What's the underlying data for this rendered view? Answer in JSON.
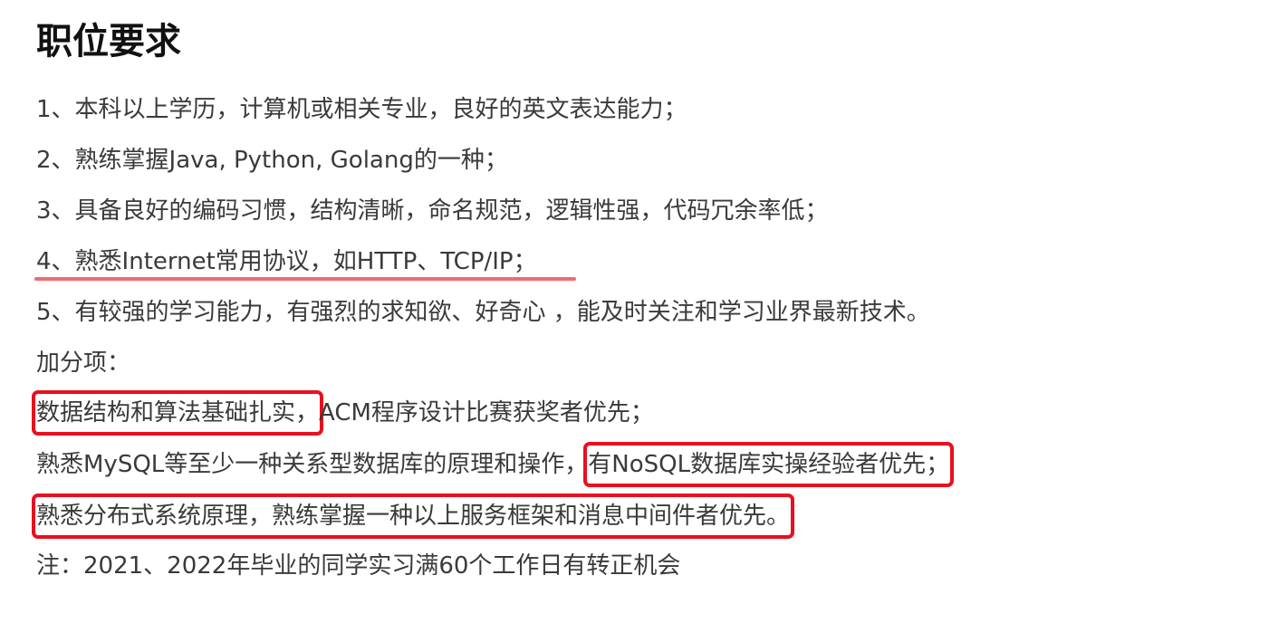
{
  "title": "职位要求",
  "requirements": [
    "1、本科以上学历，计算机或相关专业，良好的英文表达能力；",
    "2、熟练掌握Java, Python, Golang的一种；",
    "3、具备良好的编码习惯，结构清晰，命名规范，逻辑性强，代码冗余率低；",
    "4、熟悉Internet常用协议，如HTTP、TCP/IP；",
    "5、有较强的学习能力，有强烈的求知欲、好奇心 ，能及时关注和学习业界最新技术。"
  ],
  "bonus_heading": "加分项：",
  "bonus": {
    "item1_highlight": "数据结构和算法基础扎实，",
    "item1_rest": "ACM程序设计比赛获奖者优先；",
    "item2_text": "熟悉MySQL等至少一种关系型数据库的原理和操作，",
    "item2_highlight": "有NoSQL数据库实操经验者优先；",
    "item3_highlight": "熟悉分布式系统原理，熟练掌握一种以上服务框架和消息中间件者优先。"
  },
  "note": "注：2021、2022年毕业的同学实习满60个工作日有转正机会",
  "colors": {
    "highlight_box": "#e8101f",
    "underline": "#f06a6f",
    "text": "#3a3a3a",
    "title": "#111111"
  }
}
